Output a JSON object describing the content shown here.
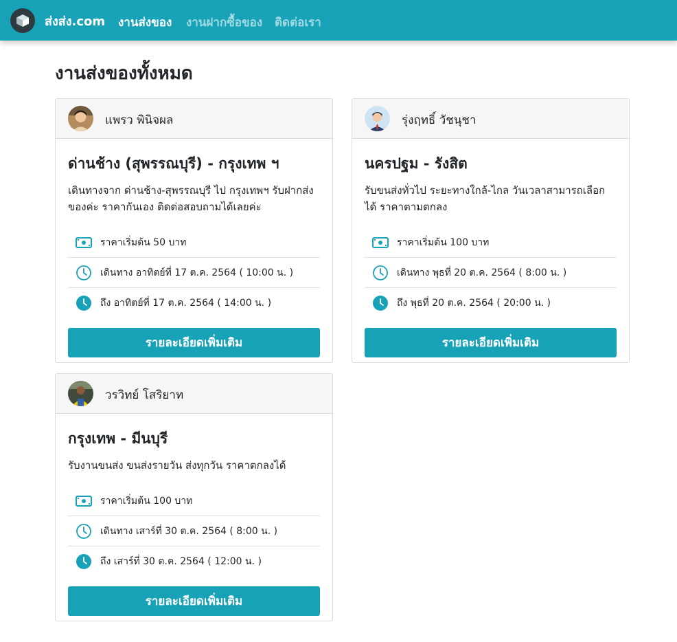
{
  "brand": {
    "name": "ส่งส่ง.com"
  },
  "nav": [
    {
      "label": "งานส่งของ",
      "active": true
    },
    {
      "label": "งานฝากซื้อของ",
      "active": false
    },
    {
      "label": "ติดต่อเรา",
      "active": false
    }
  ],
  "page": {
    "title": "งานส่งของทั้งหมด"
  },
  "colors": {
    "accent": "#17a2b8"
  },
  "jobs": [
    {
      "owner": "แพรว พินิจผล",
      "route": "ด่านช้าง (สุพรรณบุรี) - กรุงเทพ ฯ",
      "description": "เดินทางจาก ด่านช้าง-สุพรรณบุรี ไป กรุงเทพฯ รับฝากส่งของค่ะ ราคากันเอง ติดต่อสอบถามได้เลยค่ะ",
      "price": "ราคาเริ่มต้น 50 บาท",
      "depart": "เดินทาง อาทิตย์ที่ 17 ต.ค. 2564 ( 10:00 น. )",
      "arrive": "ถึง อาทิตย์ที่ 17 ต.ค. 2564 ( 14:00 น. )",
      "button": "รายละเอียดเพิ่มเติม"
    },
    {
      "owner": "รุ่งฤทธิ์ วัชนุชา",
      "route": "นครปฐม - รังสิต",
      "description": "รับขนส่งทั่วไป ระยะทางใกล้-ไกล วันเวลาสามารถเลือกได้ ราคาตามตกลง",
      "price": "ราคาเริ่มต้น 100 บาท",
      "depart": "เดินทาง พุธที่ 20 ต.ค. 2564 ( 8:00 น. )",
      "arrive": "ถึง พุธที่ 20 ต.ค. 2564 ( 20:00 น. )",
      "button": "รายละเอียดเพิ่มเติม"
    },
    {
      "owner": "วรวิทย์ โสริยาท",
      "route": "กรุงเทพ - มีนบุรี",
      "description": "รับงานขนส่ง ขนส่งรายวัน ส่งทุกวัน ราคาตกลงได้",
      "price": "ราคาเริ่มต้น 100 บาท",
      "depart": "เดินทาง เสาร์ที่ 30 ต.ค. 2564 ( 8:00 น. )",
      "arrive": "ถึง เสาร์ที่ 30 ต.ค. 2564 ( 12:00 น. )",
      "button": "รายละเอียดเพิ่มเติม"
    }
  ]
}
